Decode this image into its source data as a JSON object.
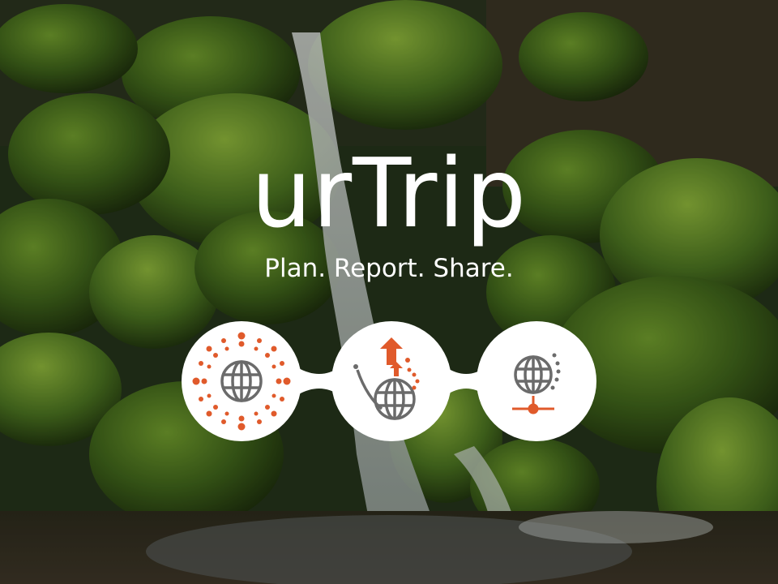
{
  "app": {
    "title": "urTrip",
    "tagline": "Plan. Report. Share."
  },
  "features": [
    {
      "icon": "sun-globe-icon"
    },
    {
      "icon": "globe-upload-arrows-icon"
    },
    {
      "icon": "globe-network-icon"
    }
  ],
  "colors": {
    "accent": "#e05a2b",
    "icon_gray": "#6b6b6b",
    "text": "#ffffff",
    "circle": "#ffffff"
  }
}
